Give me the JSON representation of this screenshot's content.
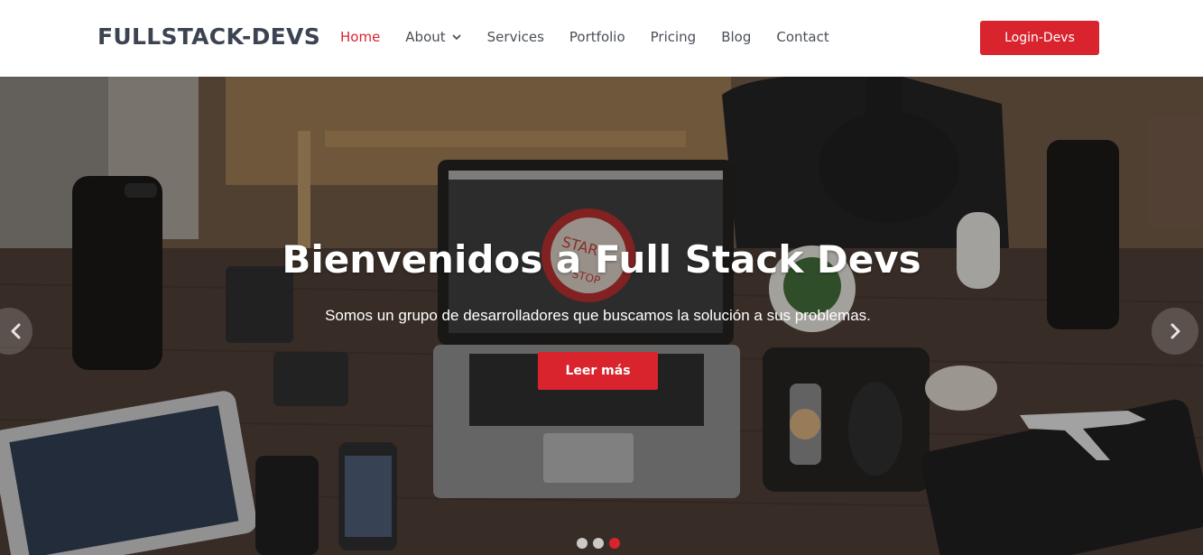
{
  "brand": {
    "name": "FULLSTACK-DEVS"
  },
  "nav": {
    "items": [
      {
        "label": "Home",
        "active": true,
        "has_dropdown": false
      },
      {
        "label": "About",
        "active": false,
        "has_dropdown": true
      },
      {
        "label": "Services",
        "active": false,
        "has_dropdown": false
      },
      {
        "label": "Portfolio",
        "active": false,
        "has_dropdown": false
      },
      {
        "label": "Pricing",
        "active": false,
        "has_dropdown": false
      },
      {
        "label": "Blog",
        "active": false,
        "has_dropdown": false
      },
      {
        "label": "Contact",
        "active": false,
        "has_dropdown": false
      }
    ],
    "login_label": "Login-Devs"
  },
  "hero": {
    "title": "Bienvenidos a Full Stack Devs",
    "subtitle": "Somos un grupo de desarrolladores que buscamos la solución a sus problemas.",
    "cta_label": "Leer más",
    "laptop_screen_text": [
      "START",
      "STOP"
    ]
  },
  "carousel": {
    "slides_count": 3,
    "active_index": 2,
    "prev_icon": "chevron-left-icon",
    "next_icon": "chevron-right-icon"
  },
  "colors": {
    "accent": "#d9232d",
    "logo_text": "#3c4451",
    "nav_text": "#4a4f57",
    "header_bg": "#ffffff"
  }
}
